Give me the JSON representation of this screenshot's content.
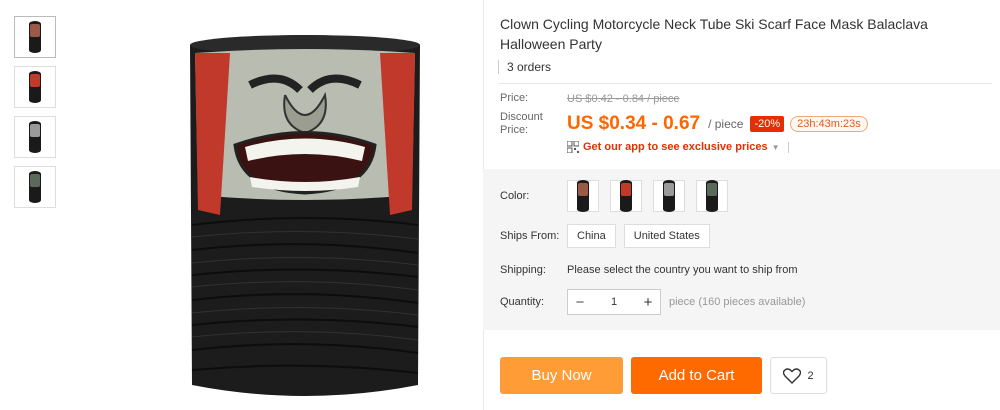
{
  "thumbnails": [
    {
      "name": "variant-1",
      "face_color": "#8a4a3a"
    },
    {
      "name": "variant-2",
      "face_color": "#c23a2a"
    },
    {
      "name": "variant-3",
      "face_color": "#9a9a9a"
    },
    {
      "name": "variant-4",
      "face_color": "#5a6a5a"
    }
  ],
  "product": {
    "title": "Clown Cycling Motorcycle Neck Tube Ski Scarf Face Mask Balaclava Halloween Party",
    "orders": "3 orders"
  },
  "price": {
    "label": "Price:",
    "original": "US $0.42 - 0.84 / piece",
    "discount_label": "Discount Price:",
    "discount": "US $0.34 - 0.67",
    "unit": "/ piece",
    "badge": "-20%",
    "timer": "23h:43m:23s",
    "app_promo": "Get our app to see exclusive prices"
  },
  "properties": {
    "color_label": "Color:",
    "ships_from_label": "Ships From:",
    "ships_from_options": [
      "China",
      "United States"
    ],
    "shipping_label": "Shipping:",
    "shipping_text": "Please select the country you want to ship from",
    "quantity_label": "Quantity:",
    "quantity_value": "1",
    "quantity_minus": "−",
    "quantity_plus": "+",
    "availability": "piece (160 pieces available)"
  },
  "actions": {
    "buy_now": "Buy Now",
    "add_to_cart": "Add to Cart",
    "wishlist_count": "2"
  },
  "colors": {
    "accent": "#ff6a00",
    "buy_now": "#ff9c36",
    "price": "#ff6600",
    "badge": "#e62e04"
  }
}
